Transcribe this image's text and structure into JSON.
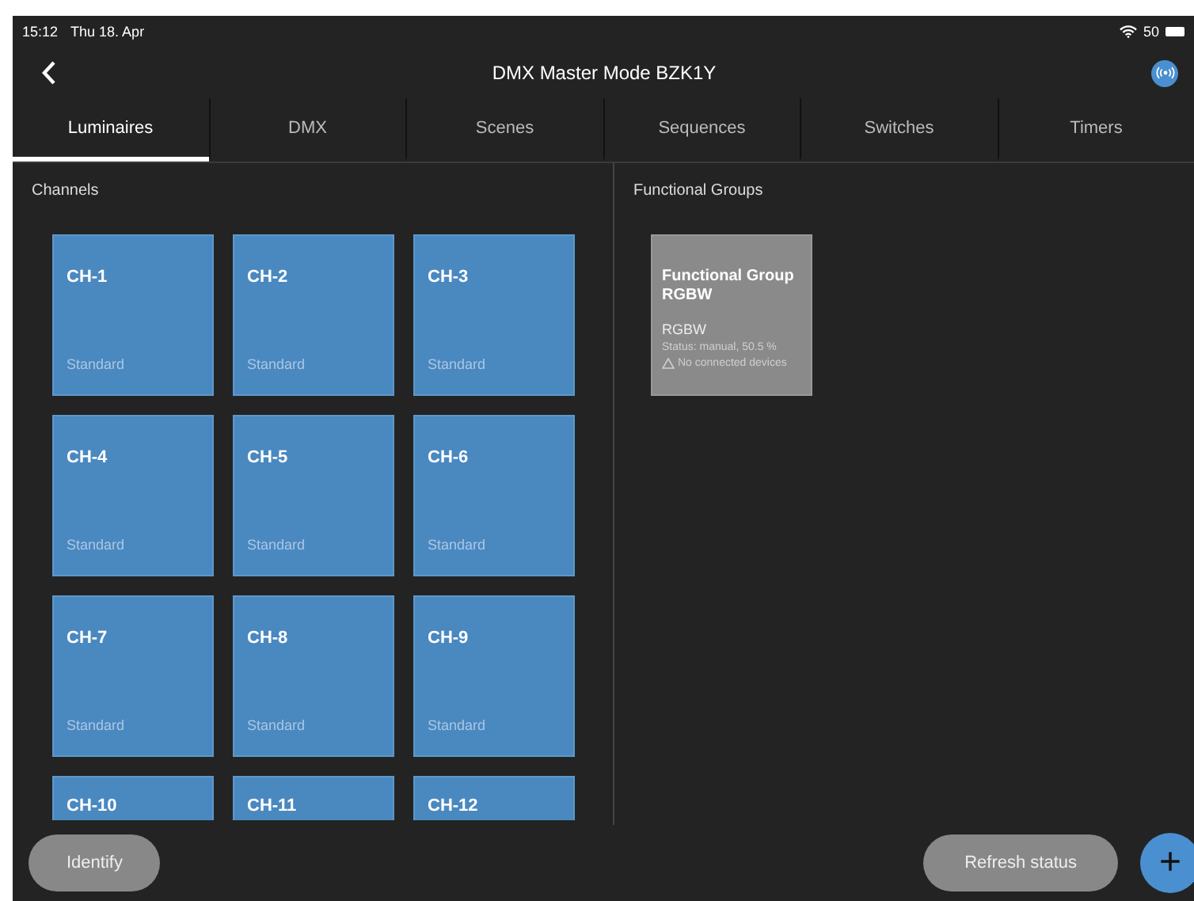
{
  "status_bar": {
    "time": "15:12",
    "date": "Thu 18. Apr",
    "battery": "50"
  },
  "nav": {
    "title": "DMX Master Mode BZK1Y"
  },
  "tabs": [
    {
      "label": "Luminaires",
      "selected": true
    },
    {
      "label": "DMX",
      "selected": false
    },
    {
      "label": "Scenes",
      "selected": false
    },
    {
      "label": "Sequences",
      "selected": false
    },
    {
      "label": "Switches",
      "selected": false
    },
    {
      "label": "Timers",
      "selected": false
    }
  ],
  "channels": {
    "heading": "Channels",
    "tiles": [
      {
        "name": "CH-1",
        "mode": "Standard"
      },
      {
        "name": "CH-2",
        "mode": "Standard"
      },
      {
        "name": "CH-3",
        "mode": "Standard"
      },
      {
        "name": "CH-4",
        "mode": "Standard"
      },
      {
        "name": "CH-5",
        "mode": "Standard"
      },
      {
        "name": "CH-6",
        "mode": "Standard"
      },
      {
        "name": "CH-7",
        "mode": "Standard"
      },
      {
        "name": "CH-8",
        "mode": "Standard"
      },
      {
        "name": "CH-9",
        "mode": "Standard"
      },
      {
        "name": "CH-10"
      },
      {
        "name": "CH-11"
      },
      {
        "name": "CH-12"
      }
    ]
  },
  "functional_groups": {
    "heading": "Functional Groups",
    "groups": [
      {
        "title": "Functional Group RGBW",
        "type": "RGBW",
        "status": "Status: manual, 50.5 %",
        "warning": "No connected devices"
      }
    ]
  },
  "bottom_bar": {
    "buttons": [
      "Identify",
      "Refresh status"
    ],
    "add_button": "+"
  }
}
